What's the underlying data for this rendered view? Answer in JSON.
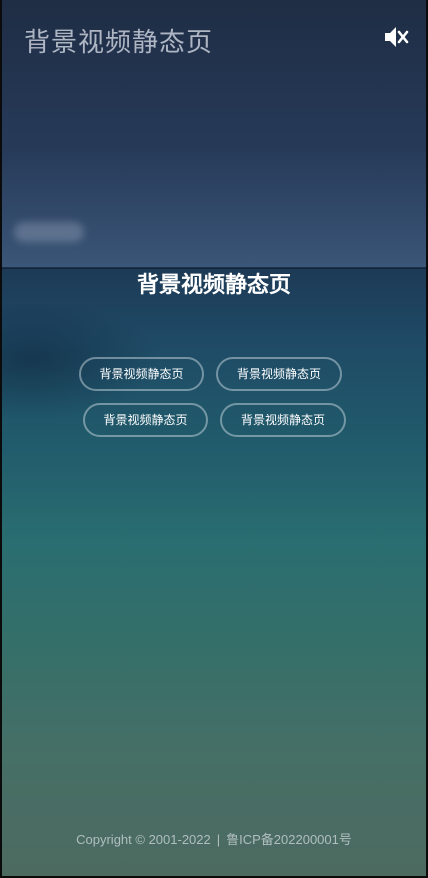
{
  "header": {
    "site_title": "背景视频静态页",
    "mute_icon": "speaker-muted-icon"
  },
  "hero": {
    "title": "背景视频静态页"
  },
  "buttons": [
    {
      "label": "背景视频静态页"
    },
    {
      "label": "背景视频静态页"
    },
    {
      "label": "背景视频静态页"
    },
    {
      "label": "背景视频静态页"
    }
  ],
  "footer": {
    "copyright": "Copyright  ©  2001-2022",
    "separator": "|",
    "icp": "鲁ICP备202200001号"
  },
  "colors": {
    "sky": "#263a58",
    "sea_top": "#1f4a66",
    "sea_bottom": "#4d6a60",
    "text": "#ffffff"
  }
}
